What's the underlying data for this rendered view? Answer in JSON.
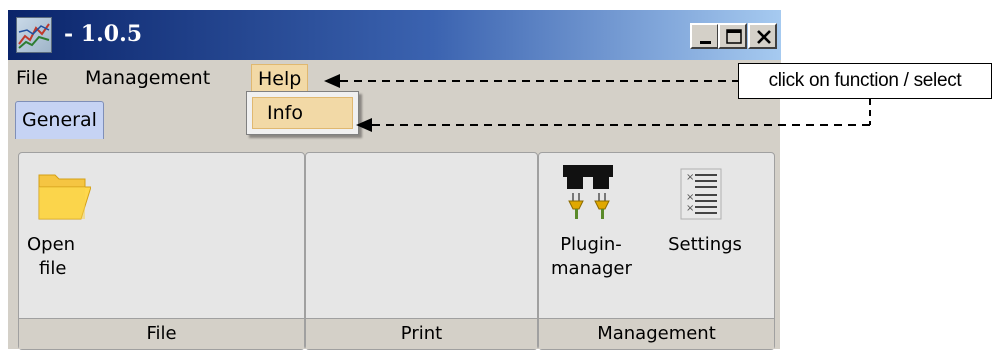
{
  "window": {
    "title": "- 1.0.5",
    "buttons": [
      {
        "name": "minimize-button",
        "icon": "minimize-icon"
      },
      {
        "name": "maximize-button",
        "icon": "maximize-icon"
      },
      {
        "name": "close-button",
        "icon": "close-icon"
      }
    ]
  },
  "menubar": {
    "items": [
      "File",
      "Management",
      "Help"
    ],
    "active": "Help"
  },
  "help_menu": {
    "items": [
      "Info"
    ]
  },
  "tabs": [
    "General"
  ],
  "groups": [
    {
      "label": "File",
      "buttons": [
        {
          "line1": "Open",
          "line2": "file",
          "icon": "folder-icon"
        }
      ]
    },
    {
      "label": "Print",
      "buttons": []
    },
    {
      "label": "Management",
      "buttons": [
        {
          "line1": "Plugin-",
          "line2": "manager",
          "icon": "plugin-icon"
        },
        {
          "line1": "Settings",
          "line2": "",
          "icon": "settings-list-icon"
        }
      ]
    }
  ],
  "annotation": {
    "callout_text": "click on function / select"
  },
  "colors": {
    "titlebar_start": "#0a246a",
    "titlebar_end": "#a6caf0",
    "menu_highlight": "#f2d9a6",
    "tab_background": "#c6d3f4",
    "window_background": "#d4d0c8"
  }
}
